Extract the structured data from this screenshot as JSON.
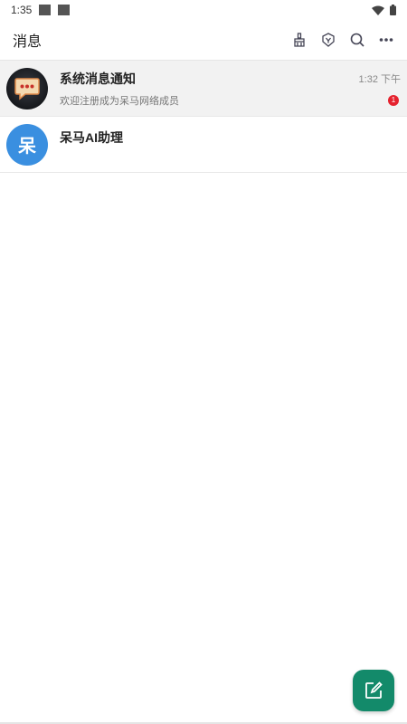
{
  "status_bar": {
    "time": "1:35",
    "icons": [
      "notification-square-icon",
      "notification-square-icon",
      "wifi-icon",
      "battery-icon"
    ]
  },
  "header": {
    "title": "消息",
    "actions": [
      "broom-icon",
      "shield-icon",
      "search-icon",
      "more-icon"
    ]
  },
  "conversations": [
    {
      "name": "系统消息通知",
      "preview": "欢迎注册成为呆马网络成员",
      "time": "1:32 下午",
      "unread": "1",
      "avatar": "chat-bubble-icon"
    },
    {
      "name": "呆马AI助理",
      "avatar_letter": "呆"
    }
  ],
  "fab": {
    "icon": "compose-icon",
    "color": "#138a6a"
  },
  "colors": {
    "badge": "#e5222e",
    "avatar_blue": "#3a8fe0"
  }
}
